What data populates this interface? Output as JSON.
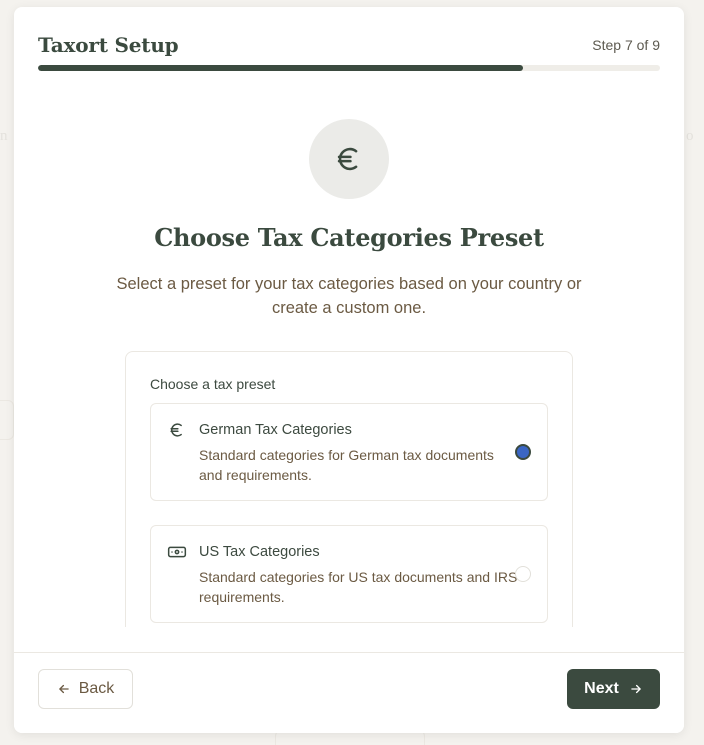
{
  "header": {
    "app_title": "Taxort Setup",
    "step_label": "Step 7 of 9",
    "progress": 0.78
  },
  "hero": {
    "icon": "euro-icon",
    "title": "Choose Tax Categories Preset",
    "subtitle": "Select a preset for your tax categories based on your country or create a custom one."
  },
  "presets": {
    "heading": "Choose a tax preset",
    "options": [
      {
        "icon": "euro-icon",
        "title": "German Tax Categories",
        "description": "Standard categories for German tax documents and requirements.",
        "selected": true
      },
      {
        "icon": "banknote-icon",
        "title": "US Tax Categories",
        "description": "Standard categories for US tax documents and IRS requirements.",
        "selected": false
      }
    ]
  },
  "footer": {
    "back_label": "Back",
    "next_label": "Next"
  },
  "colors": {
    "primary": "#3b4a3f",
    "radio_selected": "#3a66c4",
    "body_text": "#6b5a43"
  }
}
